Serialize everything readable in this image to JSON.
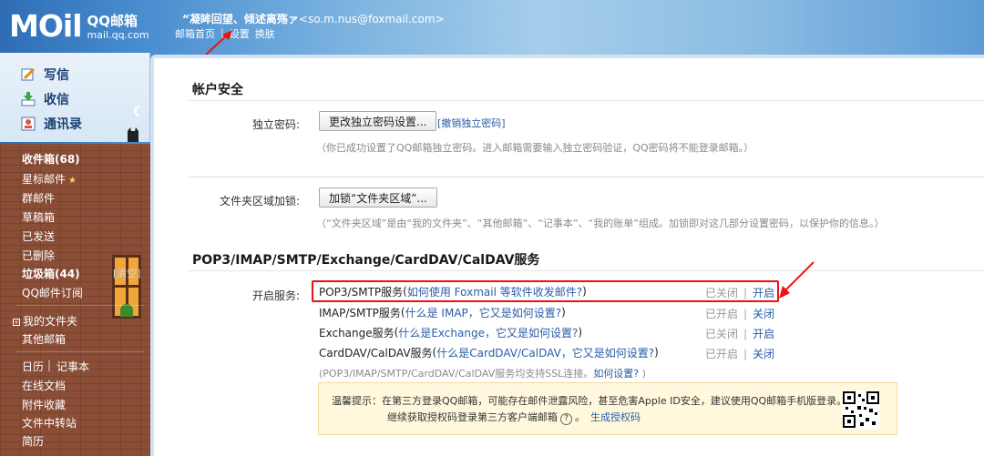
{
  "header": {
    "logo_mail": "MOil",
    "logo_cn": "QQ邮箱",
    "logo_url": "mail.qq.com",
    "user_name": "“凝眸回望、倾述离殇ァ",
    "user_email": "<so.m.nus@foxmail.com>",
    "links": [
      "邮箱首页",
      "设置",
      "换肤"
    ]
  },
  "sidebar": {
    "nav": [
      {
        "label": "写信",
        "icon": "pencil-icon"
      },
      {
        "label": "收信",
        "icon": "inbox-download-icon"
      },
      {
        "label": "通讯录",
        "icon": "contacts-icon"
      }
    ],
    "folders": {
      "inbox": "收件箱(68)",
      "starred": "星标邮件",
      "group": "群邮件",
      "drafts": "草稿箱",
      "sent": "已发送",
      "deleted": "已删除",
      "spam": "垃圾箱(44)",
      "spam_clear": "[清空]",
      "subscribe": "QQ邮件订阅",
      "my_folders": "我的文件夹",
      "other": "其他邮箱",
      "calendar": "日历",
      "notes": "记事本",
      "online_docs": "在线文档",
      "attachments": "附件收藏",
      "transfer": "文件中转站",
      "resume": "简历"
    }
  },
  "main": {
    "security_title": "帐户安全",
    "pwd_label": "独立密码:",
    "pwd_button": "更改独立密码设置...",
    "pwd_revoke": "[撤销独立密码]",
    "pwd_hint": "（你已成功设置了QQ邮箱独立密码。进入邮箱需要输入独立密码验证，QQ密码将不能登录邮箱。）",
    "lock_label": "文件夹区域加锁:",
    "lock_button": "加锁“文件夹区域”...",
    "lock_hint": "（“文件夹区域”是由“我的文件夹”、“其他邮箱”、“记事本”、“我的账单”组成。加锁即对这几部分设置密码，以保护你的信息。）",
    "pop_title": "POP3/IMAP/SMTP/Exchange/CardDAV/CalDAV服务",
    "service_label": "开启服务:",
    "services": [
      {
        "name": "POP3/SMTP服务",
        "open": " (",
        "help": "如何使用 Foxmail 等软件收发邮件?",
        "close": " )",
        "state": "已关闭",
        "action": "开启"
      },
      {
        "name": "IMAP/SMTP服务",
        "open": " (",
        "help": "什么是 IMAP，它又是如何设置?",
        "close": " )",
        "state": "已开启",
        "action": "关闭"
      },
      {
        "name": "Exchange服务",
        "open": " (",
        "help": "什么是Exchange，它又是如何设置?",
        "close": " )",
        "state": "已关闭",
        "action": "开启"
      },
      {
        "name": "CardDAV/CalDAV服务",
        "open": " (",
        "help": "什么是CardDAV/CalDAV，它又是如何设置?",
        "close": " )",
        "state": "已开启",
        "action": "关闭"
      }
    ],
    "ssl_note": "(POP3/IMAP/SMTP/CardDAV/CalDAV服务均支持SSL连接。",
    "ssl_link": "如何设置?",
    "ssl_close": " )",
    "tip_line1": "温馨提示：在第三方登录QQ邮箱，可能存在邮件泄露风险，甚至危害Apple ID安全，建议使用QQ邮箱手机版登录。",
    "tip_line2_pre": "继续获取授权码登录第三方客户端邮箱",
    "tip_line2_link": "生成授权码",
    "separator": "|"
  },
  "colors": {
    "accent": "#2a5ca6",
    "highlight": "#ee1111",
    "tip_bg": "#fff8dc"
  }
}
